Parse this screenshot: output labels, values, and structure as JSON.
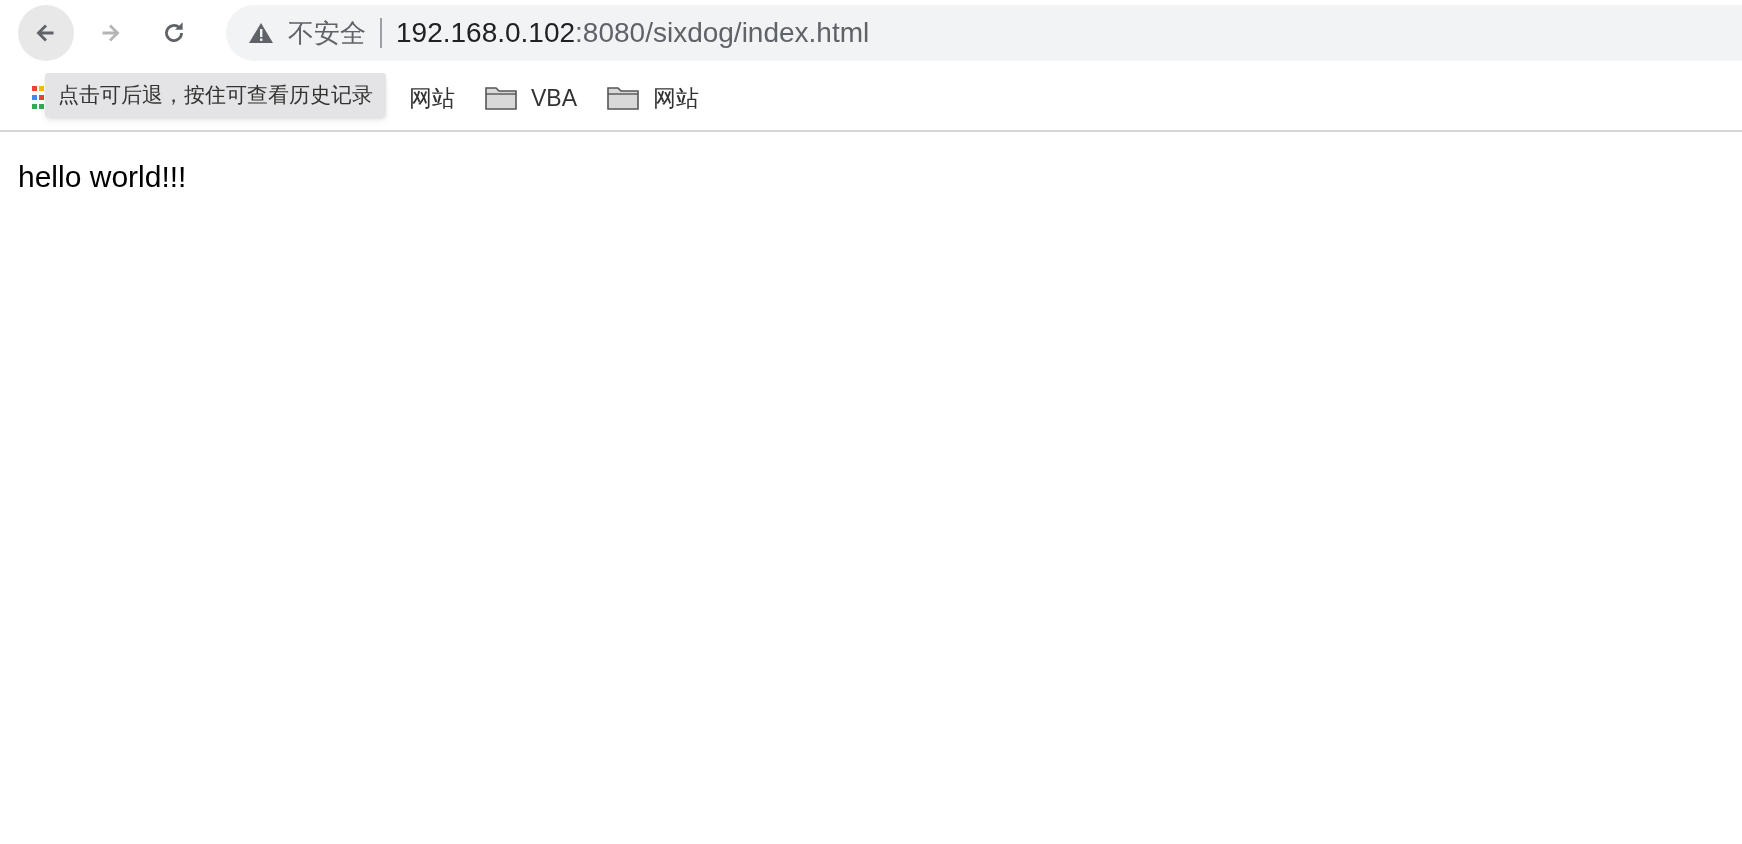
{
  "nav_buttons": [
    {
      "kind": "back",
      "disabled": false,
      "hovered": true
    },
    {
      "kind": "forward",
      "disabled": true,
      "hovered": false
    },
    {
      "kind": "reload",
      "disabled": false,
      "hovered": false
    }
  ],
  "address_bar": {
    "security_label": "不安全",
    "host": "192.168.0.102",
    "path": ":8080/sixdog/index.html"
  },
  "bookmarks": [
    {
      "kind": "apps"
    },
    {
      "kind": "text",
      "label": "网站"
    },
    {
      "kind": "folder",
      "label": "VBA"
    },
    {
      "kind": "folder",
      "label": "网站"
    }
  ],
  "tooltip": "点击可后退，按住可查看历史记录",
  "page": {
    "text": "hello world!!!"
  }
}
